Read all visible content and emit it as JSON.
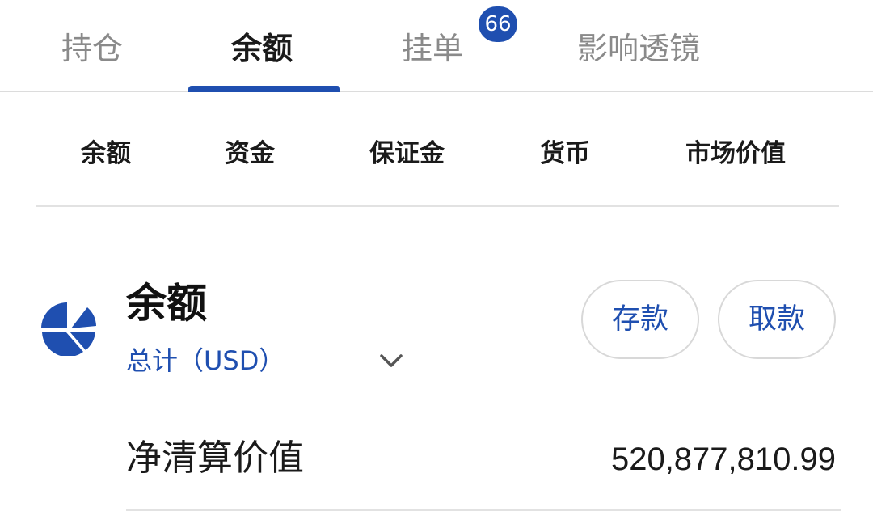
{
  "top_tabs": {
    "holdings": "持仓",
    "balance": "余额",
    "orders": "挂单",
    "orders_badge": "66",
    "impact_lens": "影响透镜"
  },
  "sub_tabs": [
    "余额",
    "资金",
    "保证金",
    "货币",
    "市场价值"
  ],
  "balance_section": {
    "icon": "pie-chart-icon",
    "title": "余额",
    "currency_label": "总计（USD）",
    "deposit_label": "存款",
    "withdraw_label": "取款"
  },
  "rows": [
    {
      "label": "净清算价值",
      "value": "520,877,810.99"
    }
  ],
  "colors": {
    "accent": "#1f4fb0",
    "divider": "#e2e2e2",
    "inactive_text": "#8a8a8a"
  }
}
